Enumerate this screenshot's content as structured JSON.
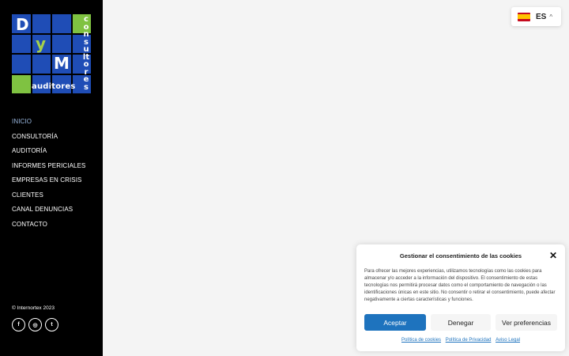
{
  "brand": {
    "letter_d": "D",
    "letter_y": "y",
    "letter_m": "M",
    "vertical_word": "consultores",
    "bottom_word": "auditores",
    "colors": {
      "blue": "#1f4db6",
      "green": "#7fc241"
    }
  },
  "nav": {
    "items": [
      {
        "label": "INICIO"
      },
      {
        "label": "CONSULTORÍA"
      },
      {
        "label": "AUDITORÍA"
      },
      {
        "label": "INFORMES PERICIALES"
      },
      {
        "label": "EMPRESAS EN CRISIS"
      },
      {
        "label": "CLIENTES"
      },
      {
        "label": "CANAL DENUNCIAS"
      },
      {
        "label": "CONTACTO"
      }
    ],
    "active": "INICIO"
  },
  "footer": {
    "copyright": "© Internortex 2023",
    "socials": [
      {
        "icon": "facebook-icon",
        "glyph": "f"
      },
      {
        "icon": "instagram-icon",
        "glyph": "◎"
      },
      {
        "icon": "twitter-icon",
        "glyph": "t"
      }
    ]
  },
  "language": {
    "code": "ES",
    "flag_icon": "spain-flag-icon",
    "caret_icon": "chevron-up-icon"
  },
  "cookie_banner": {
    "title": "Gestionar el consentimiento de las cookies",
    "close_glyph": "✕",
    "text": "Para ofrecer las mejores experiencias, utilizamos tecnologías como las cookies para almacenar y/o acceder a la información del dispositivo. El consentimiento de estas tecnologías nos permitirá procesar datos como el comportamiento de navegación o las identificaciones únicas en este sitio. No consentir o retirar el consentimiento, puede afectar negativamente a ciertas características y funciones.",
    "accept_label": "Aceptar",
    "deny_label": "Denegar",
    "prefs_label": "Ver preferencias",
    "links": {
      "cookie_policy": "Política de cookies",
      "privacy_policy": "Política de Privacidad",
      "legal_notice": "Aviso Legal"
    },
    "accent_color": "#1e73be"
  }
}
